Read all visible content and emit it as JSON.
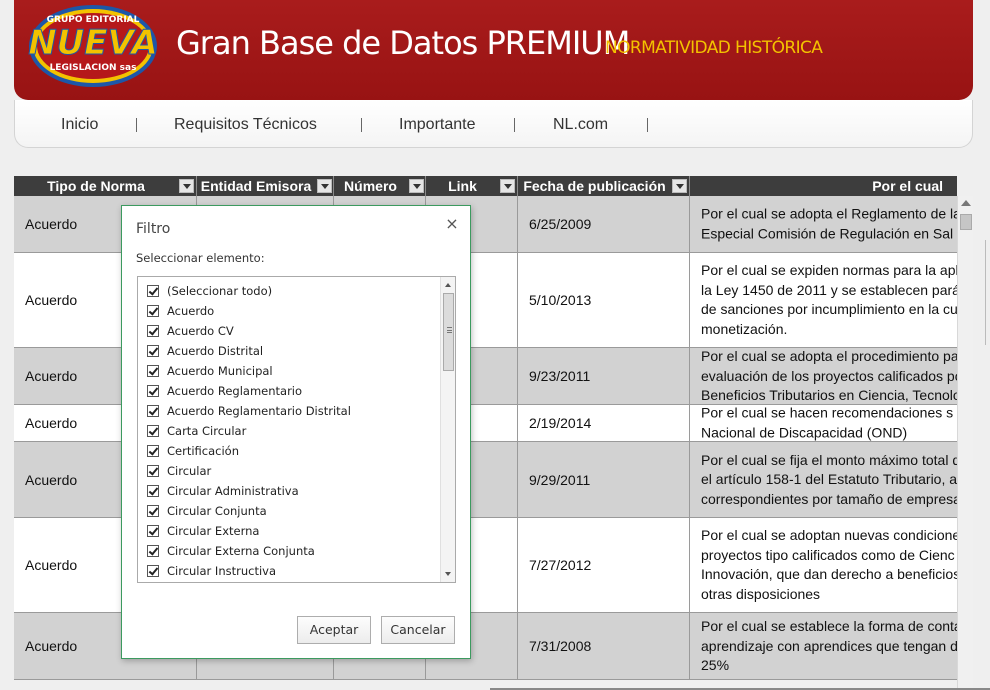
{
  "header": {
    "logo": {
      "top_text": "GRUPO EDITORIAL",
      "main_text": "NUEVA",
      "bottom_text": "LEGISLACION sas"
    },
    "title": "Gran Base de Datos PREMIUM",
    "subtitle": "NORMATIVIDAD HISTÓRICA"
  },
  "nav": {
    "items": [
      {
        "label": "Inicio"
      },
      {
        "label": "Requisitos Técnicos"
      },
      {
        "label": "Importante"
      },
      {
        "label": "NL.com"
      }
    ]
  },
  "table": {
    "columns": [
      {
        "label": "Tipo de Norma"
      },
      {
        "label": "Entidad Emisora"
      },
      {
        "label": "Número"
      },
      {
        "label": "Link"
      },
      {
        "label": "Fecha de publicación"
      },
      {
        "label": "Por el cual"
      }
    ],
    "rows": [
      {
        "tipo": "Acuerdo",
        "fecha": "6/25/2009",
        "desc": [
          "Por el cual se adopta el Reglamento de la",
          "Especial Comisión de Regulación en Sal"
        ]
      },
      {
        "tipo": "Acuerdo",
        "fecha": "5/10/2013",
        "desc": [
          "Por el cual se expiden normas para la apl",
          "la Ley 1450 de 2011 y se establecen pará",
          "de sanciones por incumplimiento en la cu",
          "monetización."
        ]
      },
      {
        "tipo": "Acuerdo",
        "fecha": "9/23/2011",
        "desc": [
          "Por el cual se adopta el procedimiento pa",
          "evaluación de los proyectos calificados po",
          "Beneficios Tributarios en Ciencia, Tecnolo"
        ]
      },
      {
        "tipo": "Acuerdo",
        "fecha": "2/19/2014",
        "desc": [
          "Por el cual se hacen recomendaciones s",
          "Nacional de Discapacidad (OND)"
        ]
      },
      {
        "tipo": "Acuerdo",
        "fecha": "9/29/2011",
        "desc": [
          "Por el cual se fija el monto máximo total d",
          "el artículo 158-1 del Estatuto Tributario, as",
          "correspondientes por tamaño de empresa"
        ]
      },
      {
        "tipo": "Acuerdo",
        "fecha": "7/27/2012",
        "desc": [
          "Por el cual se adoptan nuevas condicione",
          "proyectos tipo calificados como de Cienc",
          "Innovación, que dan derecho a beneficios",
          "otras disposiciones"
        ]
      },
      {
        "tipo": "Acuerdo",
        "fecha": "7/31/2008",
        "desc": [
          "Por el cual se establece la forma de conta",
          "aprendizaje con aprendices que tengan d",
          "25%"
        ]
      }
    ]
  },
  "filter_dialog": {
    "title": "Filtro",
    "close_symbol": "×",
    "label": "Seleccionar elemento:",
    "items": [
      {
        "label": "(Seleccionar todo)",
        "checked": true
      },
      {
        "label": "Acuerdo",
        "checked": true
      },
      {
        "label": "Acuerdo CV",
        "checked": true
      },
      {
        "label": "Acuerdo Distrital",
        "checked": true
      },
      {
        "label": "Acuerdo Municipal",
        "checked": true
      },
      {
        "label": "Acuerdo Reglamentario",
        "checked": true
      },
      {
        "label": "Acuerdo Reglamentario Distrital",
        "checked": true
      },
      {
        "label": "Carta Circular",
        "checked": true
      },
      {
        "label": "Certificación",
        "checked": true
      },
      {
        "label": "Circular",
        "checked": true
      },
      {
        "label": "Circular Administrativa",
        "checked": true
      },
      {
        "label": "Circular Conjunta",
        "checked": true
      },
      {
        "label": "Circular Externa",
        "checked": true
      },
      {
        "label": "Circular Externa Conjunta",
        "checked": true
      },
      {
        "label": "Circular Instructiva",
        "checked": true
      }
    ],
    "accept_label": "Aceptar",
    "cancel_label": "Cancelar"
  },
  "colors": {
    "header_red": "#a91c1c",
    "subtitle_yellow": "#f3c200",
    "grid_header": "#3d3d3d",
    "row_odd": "#d2d2d2",
    "dialog_border": "#3c9a5f"
  }
}
